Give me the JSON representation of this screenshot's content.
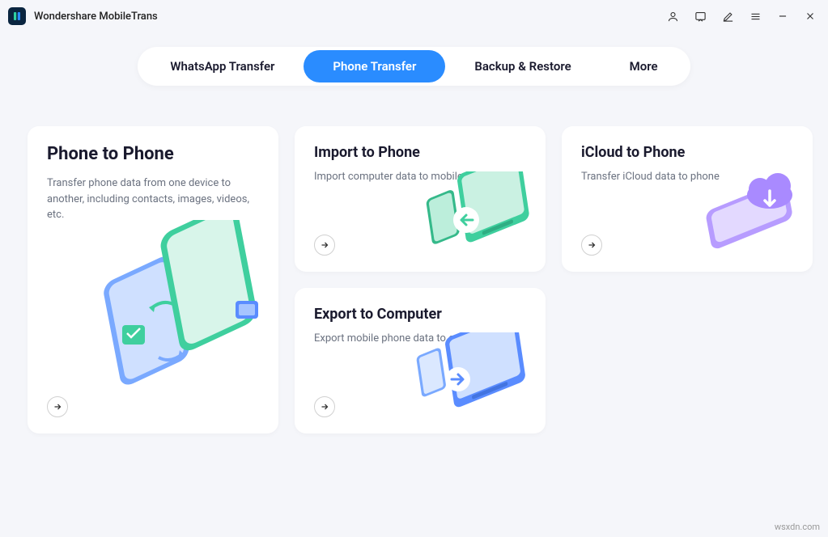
{
  "app": {
    "title": "Wondershare MobileTrans"
  },
  "nav": {
    "items": [
      {
        "label": "WhatsApp Transfer",
        "active": false
      },
      {
        "label": "Phone Transfer",
        "active": true
      },
      {
        "label": "Backup & Restore",
        "active": false
      },
      {
        "label": "More",
        "active": false
      }
    ]
  },
  "cards": {
    "phone_to_phone": {
      "title": "Phone to Phone",
      "desc": "Transfer phone data from one device to another, including contacts, images, videos, etc."
    },
    "import_to_phone": {
      "title": "Import to Phone",
      "desc": "Import computer data to mobile phone"
    },
    "export_to_computer": {
      "title": "Export to Computer",
      "desc": "Export mobile phone data to computer"
    },
    "icloud_to_phone": {
      "title": "iCloud to Phone",
      "desc": "Transfer iCloud data to phone"
    }
  },
  "watermark": "wsxdn.com"
}
